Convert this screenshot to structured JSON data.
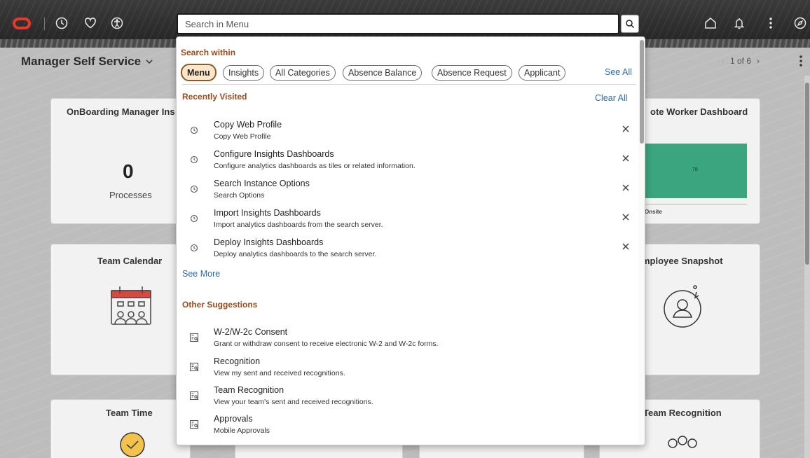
{
  "header": {
    "search_placeholder": "Search in Menu",
    "icons": [
      "oracle-logo",
      "recent-places-icon",
      "favorites-icon",
      "accessibility-icon",
      "search-icon",
      "home-icon",
      "notifications-icon",
      "actions-menu-icon",
      "navigator-icon"
    ]
  },
  "page": {
    "title": "Manager Self Service",
    "pager": "1 of 6",
    "tiles": {
      "onboarding": {
        "title": "OnBoarding Manager Ins",
        "value": "0",
        "label": "Processes"
      },
      "remote": {
        "title": "ote Worker Dashboard",
        "bar_value": "78",
        "bar_label": "Onsite"
      },
      "team_calendar": {
        "title": "Team Calendar"
      },
      "employee_snapshot": {
        "title": "mployee Snapshot"
      },
      "team_time": {
        "title": "Team Time"
      },
      "team_recognition": {
        "title": "Team Recognition"
      }
    }
  },
  "dropdown": {
    "search_within_label": "Search within",
    "see_all": "See All",
    "chips": [
      "Menu",
      "Insights",
      "All Categories",
      "Absence Balance",
      "Absence Request",
      "Applicant"
    ],
    "recent_label": "Recently Visited",
    "clear_all": "Clear All",
    "recent": [
      {
        "title": "Copy Web Profile",
        "desc": "Copy Web Profile"
      },
      {
        "title": "Configure Insights Dashboards",
        "desc": "Configure analytics dashboards as tiles or related information."
      },
      {
        "title": "Search Instance Options",
        "desc": "Search Options"
      },
      {
        "title": "Import Insights Dashboards",
        "desc": "Import analytics dashboards from the search server."
      },
      {
        "title": "Deploy Insights Dashboards",
        "desc": "Deploy analytics dashboards to the search server."
      }
    ],
    "see_more": "See More",
    "other_label": "Other Suggestions",
    "suggestions": [
      {
        "title": "W-2/W-2c Consent",
        "desc": "Grant or withdraw consent to receive electronic W-2 and W-2c forms."
      },
      {
        "title": "Recognition",
        "desc": "View my sent and received recognitions."
      },
      {
        "title": "Team Recognition",
        "desc": "View your team's sent and received recognitions."
      },
      {
        "title": "Approvals",
        "desc": "Mobile Approvals"
      }
    ]
  },
  "colors": {
    "brand_red": "#e8382c",
    "section_heading": "#a04a1a",
    "link": "#2a6db5",
    "active_chip_bg": "#fbe6c9",
    "chart_green": "#3aa57e"
  }
}
